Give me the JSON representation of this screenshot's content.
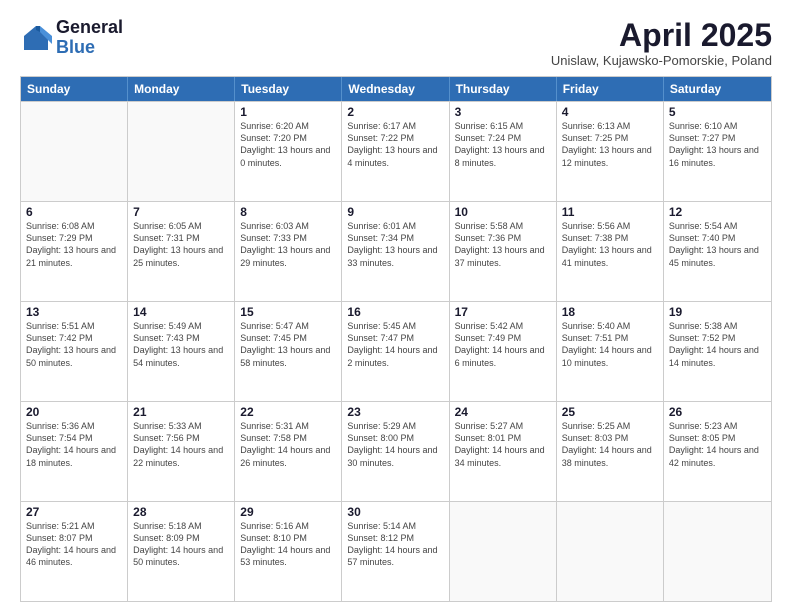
{
  "logo": {
    "general": "General",
    "blue": "Blue"
  },
  "title": "April 2025",
  "location": "Unislaw, Kujawsko-Pomorskie, Poland",
  "headers": [
    "Sunday",
    "Monday",
    "Tuesday",
    "Wednesday",
    "Thursday",
    "Friday",
    "Saturday"
  ],
  "weeks": [
    [
      {
        "day": "",
        "info": ""
      },
      {
        "day": "",
        "info": ""
      },
      {
        "day": "1",
        "info": "Sunrise: 6:20 AM\nSunset: 7:20 PM\nDaylight: 13 hours and 0 minutes."
      },
      {
        "day": "2",
        "info": "Sunrise: 6:17 AM\nSunset: 7:22 PM\nDaylight: 13 hours and 4 minutes."
      },
      {
        "day": "3",
        "info": "Sunrise: 6:15 AM\nSunset: 7:24 PM\nDaylight: 13 hours and 8 minutes."
      },
      {
        "day": "4",
        "info": "Sunrise: 6:13 AM\nSunset: 7:25 PM\nDaylight: 13 hours and 12 minutes."
      },
      {
        "day": "5",
        "info": "Sunrise: 6:10 AM\nSunset: 7:27 PM\nDaylight: 13 hours and 16 minutes."
      }
    ],
    [
      {
        "day": "6",
        "info": "Sunrise: 6:08 AM\nSunset: 7:29 PM\nDaylight: 13 hours and 21 minutes."
      },
      {
        "day": "7",
        "info": "Sunrise: 6:05 AM\nSunset: 7:31 PM\nDaylight: 13 hours and 25 minutes."
      },
      {
        "day": "8",
        "info": "Sunrise: 6:03 AM\nSunset: 7:33 PM\nDaylight: 13 hours and 29 minutes."
      },
      {
        "day": "9",
        "info": "Sunrise: 6:01 AM\nSunset: 7:34 PM\nDaylight: 13 hours and 33 minutes."
      },
      {
        "day": "10",
        "info": "Sunrise: 5:58 AM\nSunset: 7:36 PM\nDaylight: 13 hours and 37 minutes."
      },
      {
        "day": "11",
        "info": "Sunrise: 5:56 AM\nSunset: 7:38 PM\nDaylight: 13 hours and 41 minutes."
      },
      {
        "day": "12",
        "info": "Sunrise: 5:54 AM\nSunset: 7:40 PM\nDaylight: 13 hours and 45 minutes."
      }
    ],
    [
      {
        "day": "13",
        "info": "Sunrise: 5:51 AM\nSunset: 7:42 PM\nDaylight: 13 hours and 50 minutes."
      },
      {
        "day": "14",
        "info": "Sunrise: 5:49 AM\nSunset: 7:43 PM\nDaylight: 13 hours and 54 minutes."
      },
      {
        "day": "15",
        "info": "Sunrise: 5:47 AM\nSunset: 7:45 PM\nDaylight: 13 hours and 58 minutes."
      },
      {
        "day": "16",
        "info": "Sunrise: 5:45 AM\nSunset: 7:47 PM\nDaylight: 14 hours and 2 minutes."
      },
      {
        "day": "17",
        "info": "Sunrise: 5:42 AM\nSunset: 7:49 PM\nDaylight: 14 hours and 6 minutes."
      },
      {
        "day": "18",
        "info": "Sunrise: 5:40 AM\nSunset: 7:51 PM\nDaylight: 14 hours and 10 minutes."
      },
      {
        "day": "19",
        "info": "Sunrise: 5:38 AM\nSunset: 7:52 PM\nDaylight: 14 hours and 14 minutes."
      }
    ],
    [
      {
        "day": "20",
        "info": "Sunrise: 5:36 AM\nSunset: 7:54 PM\nDaylight: 14 hours and 18 minutes."
      },
      {
        "day": "21",
        "info": "Sunrise: 5:33 AM\nSunset: 7:56 PM\nDaylight: 14 hours and 22 minutes."
      },
      {
        "day": "22",
        "info": "Sunrise: 5:31 AM\nSunset: 7:58 PM\nDaylight: 14 hours and 26 minutes."
      },
      {
        "day": "23",
        "info": "Sunrise: 5:29 AM\nSunset: 8:00 PM\nDaylight: 14 hours and 30 minutes."
      },
      {
        "day": "24",
        "info": "Sunrise: 5:27 AM\nSunset: 8:01 PM\nDaylight: 14 hours and 34 minutes."
      },
      {
        "day": "25",
        "info": "Sunrise: 5:25 AM\nSunset: 8:03 PM\nDaylight: 14 hours and 38 minutes."
      },
      {
        "day": "26",
        "info": "Sunrise: 5:23 AM\nSunset: 8:05 PM\nDaylight: 14 hours and 42 minutes."
      }
    ],
    [
      {
        "day": "27",
        "info": "Sunrise: 5:21 AM\nSunset: 8:07 PM\nDaylight: 14 hours and 46 minutes."
      },
      {
        "day": "28",
        "info": "Sunrise: 5:18 AM\nSunset: 8:09 PM\nDaylight: 14 hours and 50 minutes."
      },
      {
        "day": "29",
        "info": "Sunrise: 5:16 AM\nSunset: 8:10 PM\nDaylight: 14 hours and 53 minutes."
      },
      {
        "day": "30",
        "info": "Sunrise: 5:14 AM\nSunset: 8:12 PM\nDaylight: 14 hours and 57 minutes."
      },
      {
        "day": "",
        "info": ""
      },
      {
        "day": "",
        "info": ""
      },
      {
        "day": "",
        "info": ""
      }
    ]
  ]
}
